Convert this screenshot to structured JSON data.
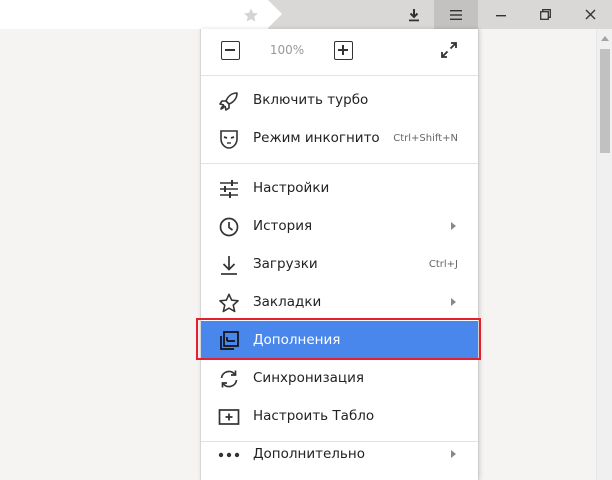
{
  "toolbar": {
    "icons": {
      "bookmark": "star-icon",
      "downloads": "download-icon",
      "menu": "hamburger-menu-icon",
      "minimize": "minimize-icon",
      "restore": "restore-icon",
      "close": "close-icon"
    }
  },
  "menu": {
    "zoom": {
      "value": "100%"
    },
    "items": [
      {
        "label": "Включить турбо",
        "icon": "rocket-icon",
        "shortcut": "",
        "submenu": false
      },
      {
        "label": "Режим инкогнито",
        "icon": "incognito-mask-icon",
        "shortcut": "Ctrl+Shift+N",
        "submenu": false
      },
      {
        "label": "Настройки",
        "icon": "settings-sliders-icon",
        "shortcut": "",
        "submenu": false
      },
      {
        "label": "История",
        "icon": "clock-icon",
        "shortcut": "",
        "submenu": true
      },
      {
        "label": "Загрузки",
        "icon": "download-icon",
        "shortcut": "Ctrl+J",
        "submenu": false
      },
      {
        "label": "Закладки",
        "icon": "star-icon",
        "shortcut": "",
        "submenu": true
      },
      {
        "label": "Дополнения",
        "icon": "extensions-icon",
        "shortcut": "",
        "submenu": false,
        "active": true
      },
      {
        "label": "Синхронизация",
        "icon": "sync-icon",
        "shortcut": "",
        "submenu": false
      },
      {
        "label": "Настроить Табло",
        "icon": "add-tile-icon",
        "shortcut": "",
        "submenu": false
      },
      {
        "label": "Дополнительно",
        "icon": "more-dots-icon",
        "shortcut": "",
        "submenu": true
      }
    ]
  },
  "colors": {
    "active_item": "#4a87ec",
    "highlight_frame": "#e5202e",
    "toolbar": "#d9d8d6"
  }
}
